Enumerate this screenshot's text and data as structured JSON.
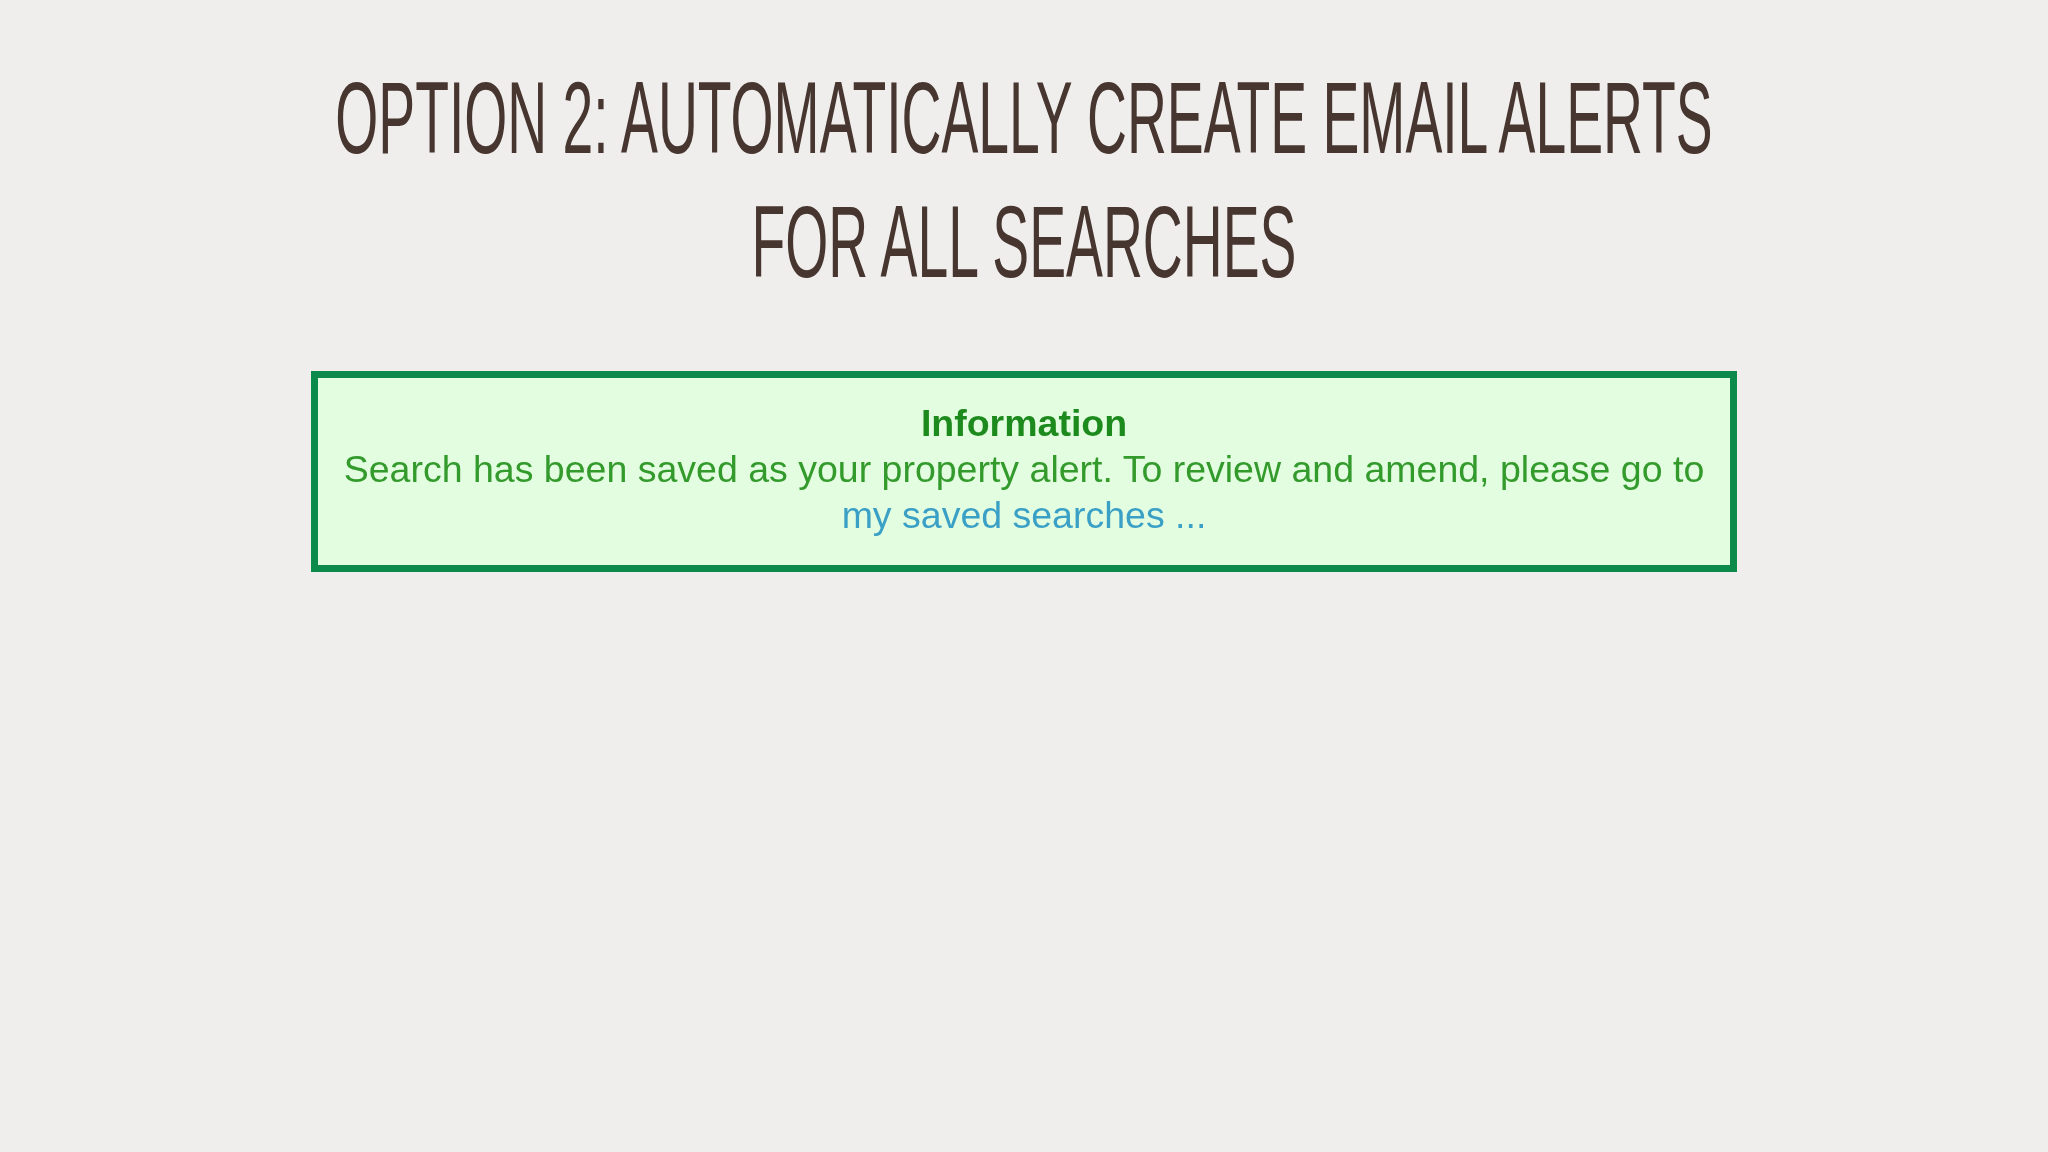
{
  "title": "OPTION 2: AUTOMATICALLY CREATE EMAIL ALERTS FOR ALL SEARCHES",
  "notice": {
    "heading": "Information",
    "message": "Search has been saved as your property alert. To review and amend, please go to",
    "link": "my saved searches ..."
  }
}
